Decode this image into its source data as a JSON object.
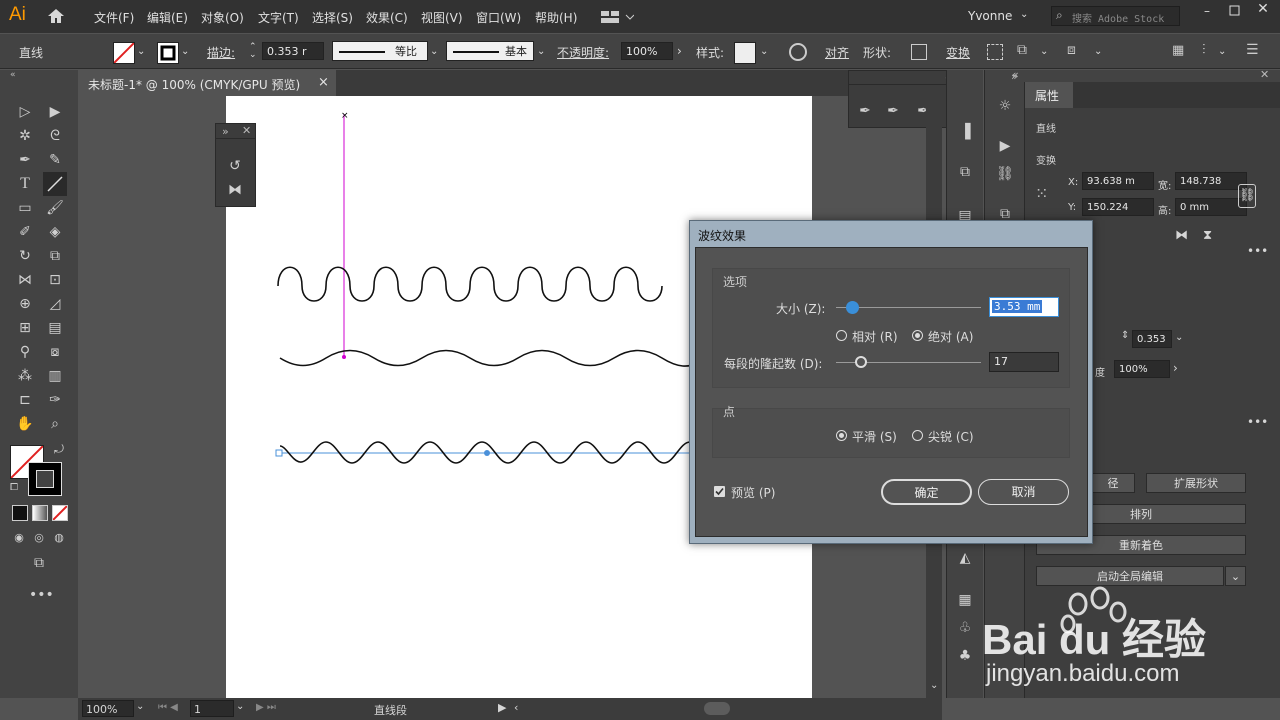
{
  "menubar": {
    "app_logo": "Ai",
    "items": [
      "文件(F)",
      "编辑(E)",
      "对象(O)",
      "文字(T)",
      "选择(S)",
      "效果(C)",
      "视图(V)",
      "窗口(W)",
      "帮助(H)"
    ],
    "user": "Yvonne",
    "search_placeholder": "搜索 Adobe Stock"
  },
  "controlbar": {
    "object_type": "直线",
    "stroke_label": "描边:",
    "stroke_value": "0.353 r",
    "profile_label": "等比",
    "brush_label": "基本",
    "opacity_label": "不透明度:",
    "opacity_value": "100%",
    "style_label": "样式:",
    "align_label": "对齐",
    "shape_label": "形状:",
    "transform_label": "变换"
  },
  "document": {
    "tab_title": "未标题-1* @ 100% (CMYK/GPU 预览)",
    "close": "×"
  },
  "statusbar": {
    "zoom": "100%",
    "page": "1",
    "tool_info": "直线段"
  },
  "properties": {
    "tab": "属性",
    "section_object": "直线",
    "section_transform": "变换",
    "x_label": "X:",
    "x_value": "93.638 m",
    "w_label": "宽:",
    "w_value": "148.738",
    "y_label": "Y:",
    "y_value": "150.224",
    "h_label": "高:",
    "h_value": "0 mm",
    "stroke_value": "0.353",
    "opacity_label": "度",
    "opacity_value": "100%",
    "btn_path": "径",
    "btn_expand": "扩展形状",
    "btn_arrange": "排列",
    "btn_recolor": "重新着色",
    "btn_global_edit": "启动全局编辑"
  },
  "dialog": {
    "title": "波纹效果",
    "options_group": "选项",
    "size_label": "大小 (Z):",
    "size_value": "3.53 mm",
    "size_fraction": 0.1,
    "relative_label": "相对 (R)",
    "absolute_label": "绝对 (A)",
    "ridges_label": "每段的隆起数 (D):",
    "ridges_value": "17",
    "ridges_fraction": 0.17,
    "points_group": "点",
    "smooth_label": "平滑 (S)",
    "corner_label": "尖锐 (C)",
    "preview_label": "预览 (P)",
    "ok_label": "确定",
    "cancel_label": "取消"
  },
  "watermark": {
    "brand": "Bai du 经验",
    "url": "jingyan.baidu.com"
  },
  "colors": {
    "accent": "#ff9a00",
    "selection": "#d100d1",
    "path_blue": "#4a90d9",
    "dialog_frame": "#9fb0bf"
  }
}
